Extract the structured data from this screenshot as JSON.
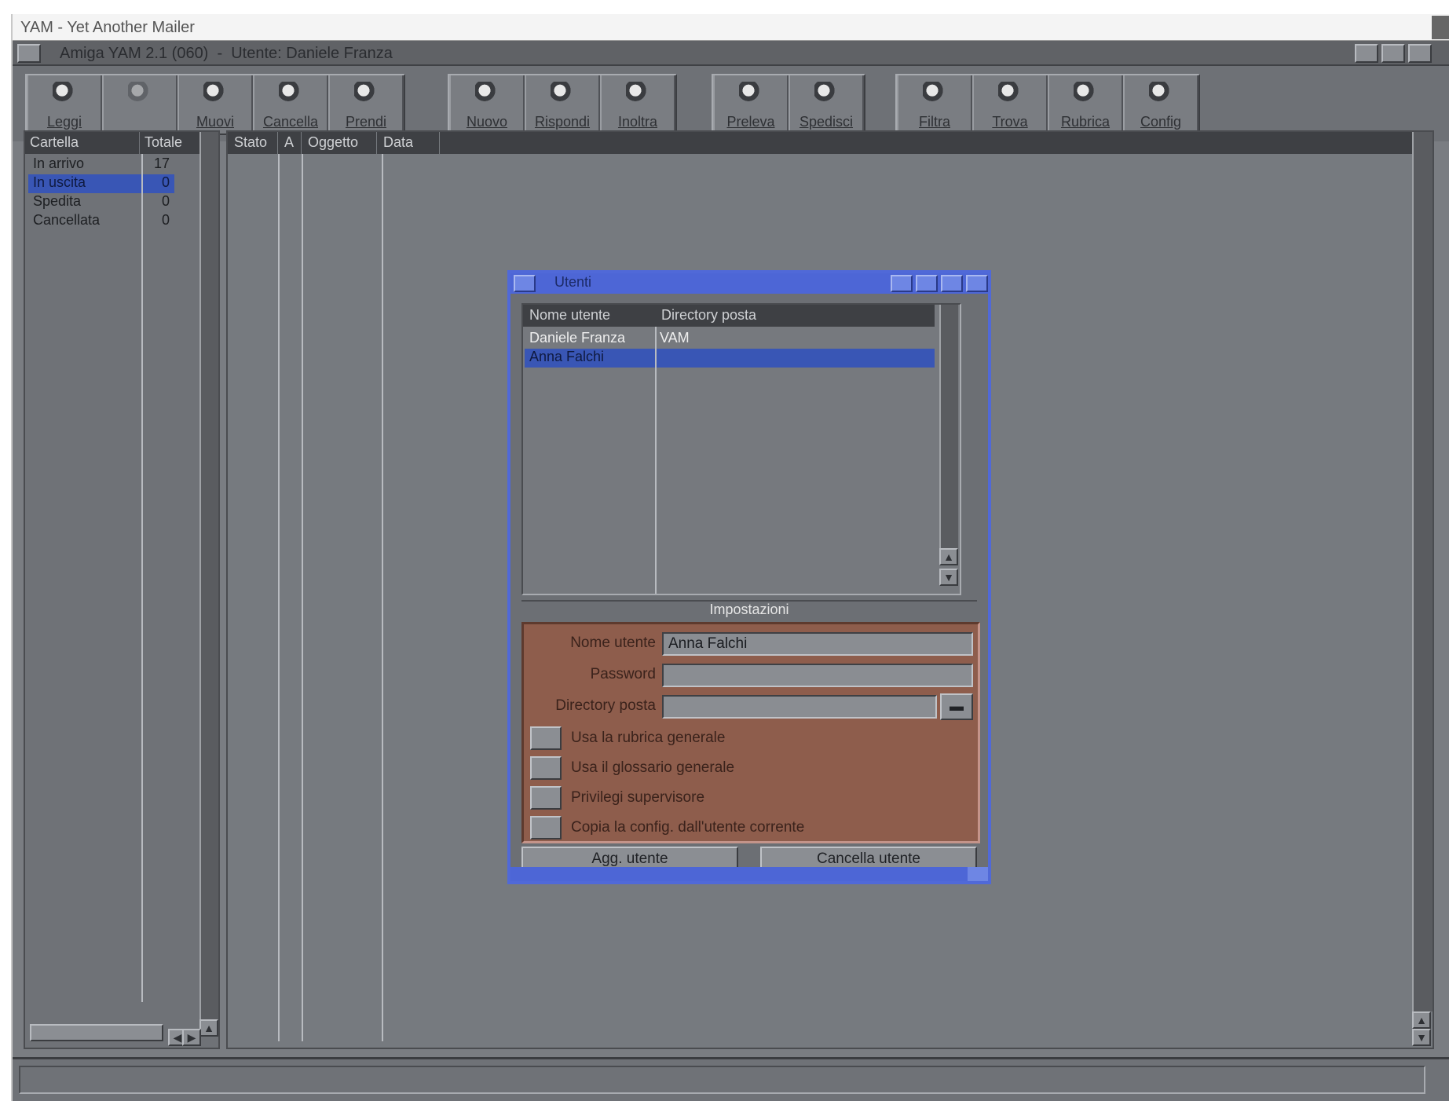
{
  "host_window": {
    "title": "YAM - Yet Another Mailer"
  },
  "screen": {
    "title": "Amiga YAM 2.1 (060)  -  Utente: Daniele Franza"
  },
  "toolbar": {
    "buttons": [
      {
        "label": "Leggi",
        "icon": "read-mail-icon"
      },
      {
        "label": "",
        "icon": "edit-icon"
      },
      {
        "label": "Muovi",
        "icon": "move-icon"
      },
      {
        "label": "Cancella",
        "icon": "delete-icon"
      },
      {
        "label": "Prendi",
        "icon": "get-icon"
      },
      {
        "label": "Nuovo",
        "icon": "new-message-icon"
      },
      {
        "label": "Rispondi",
        "icon": "reply-icon"
      },
      {
        "label": "Inoltra",
        "icon": "forward-icon"
      },
      {
        "label": "Preleva",
        "icon": "fetch-icon"
      },
      {
        "label": "Spedisci",
        "icon": "send-icon"
      },
      {
        "label": "Filtra",
        "icon": "filter-icon"
      },
      {
        "label": "Trova",
        "icon": "search-icon"
      },
      {
        "label": "Rubrica",
        "icon": "address-book-icon"
      },
      {
        "label": "Config",
        "icon": "config-icon"
      }
    ]
  },
  "folders": {
    "columns": [
      "Cartella",
      "Totale"
    ],
    "items": [
      {
        "name": "In arrivo",
        "count": "17"
      },
      {
        "name": "In uscita",
        "count": "0"
      },
      {
        "name": "Spedita",
        "count": "0"
      },
      {
        "name": "Cancellata",
        "count": "0"
      }
    ],
    "selected_index": 1
  },
  "messages": {
    "columns": [
      "Stato",
      "A",
      "Oggetto",
      "Data"
    ]
  },
  "users_dialog": {
    "title": "Utenti",
    "list_columns": [
      "Nome utente",
      "Directory posta"
    ],
    "users": [
      {
        "name": "Daniele Franza",
        "dir": "VAM"
      },
      {
        "name": "Anna Falchi",
        "dir": ""
      }
    ],
    "selected_index": 1,
    "settings_label": "Impostazioni",
    "fields": {
      "username_label": "Nome utente",
      "username_value": "Anna Falchi",
      "password_label": "Password",
      "password_value": "",
      "maildir_label": "Directory posta",
      "maildir_value": ""
    },
    "options": [
      "Usa la rubrica generale",
      "Usa il glossario generale",
      "Privilegi supervisore",
      "Copia la config. dall'utente corrente"
    ],
    "add_button": "Agg. utente",
    "delete_button": "Cancella utente"
  },
  "colors": {
    "screen_gray": "#7a7d82",
    "window_blue": "#5069d8",
    "selection_blue": "#3956b5",
    "settings_brown": "#8e5d4c"
  }
}
